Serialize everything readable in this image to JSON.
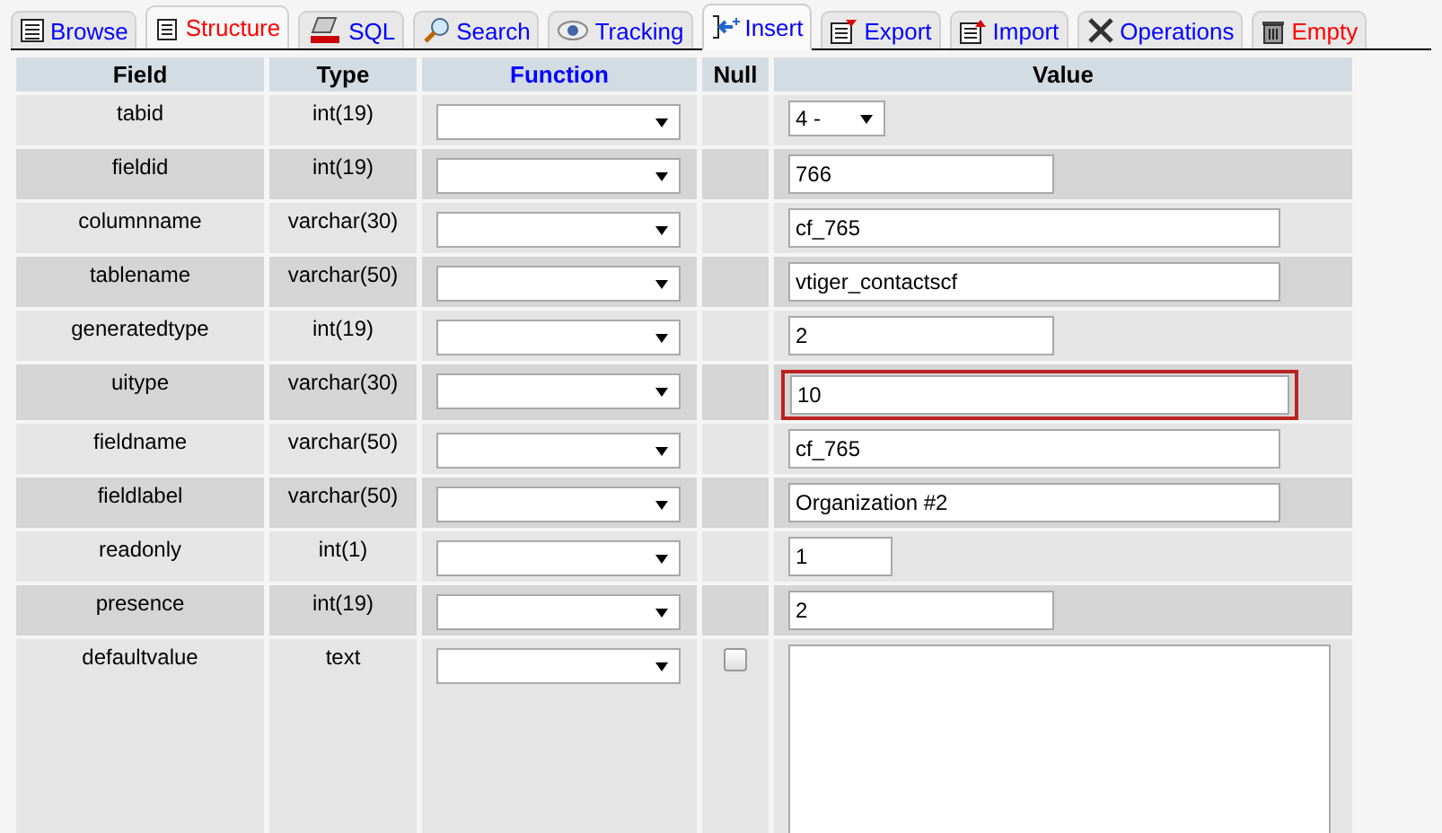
{
  "tabs": [
    {
      "label": "Browse",
      "selected": false,
      "hovered": false,
      "color": "#0000ff"
    },
    {
      "label": "Structure",
      "selected": false,
      "hovered": true,
      "color": "#ff0000"
    },
    {
      "label": "SQL",
      "selected": false,
      "hovered": false,
      "color": "#0000ff"
    },
    {
      "label": "Search",
      "selected": false,
      "hovered": false,
      "color": "#0000ff"
    },
    {
      "label": "Tracking",
      "selected": false,
      "hovered": false,
      "color": "#0000ff"
    },
    {
      "label": "Insert",
      "selected": true,
      "hovered": false,
      "color": "#0000ff"
    },
    {
      "label": "Export",
      "selected": false,
      "hovered": false,
      "color": "#0000ff"
    },
    {
      "label": "Import",
      "selected": false,
      "hovered": false,
      "color": "#0000ff"
    },
    {
      "label": "Operations",
      "selected": false,
      "hovered": false,
      "color": "#0000ff"
    },
    {
      "label": "Empty",
      "selected": false,
      "hovered": false,
      "color": "#ff0000"
    }
  ],
  "table": {
    "columns": [
      "Field",
      "Type",
      "Function",
      "Null",
      "Value"
    ],
    "rows": [
      {
        "field": "tabid",
        "type": "int(19)",
        "value": {
          "kind": "select",
          "text": "4 -"
        },
        "highlighted": false
      },
      {
        "field": "fieldid",
        "type": "int(19)",
        "value": {
          "kind": "input-medium",
          "text": "766"
        },
        "highlighted": false
      },
      {
        "field": "columnname",
        "type": "varchar(30)",
        "value": {
          "kind": "input-large",
          "text": "cf_765"
        },
        "highlighted": false
      },
      {
        "field": "tablename",
        "type": "varchar(50)",
        "value": {
          "kind": "input-large",
          "text": "vtiger_contactscf"
        },
        "highlighted": false
      },
      {
        "field": "generatedtype",
        "type": "int(19)",
        "value": {
          "kind": "input-medium",
          "text": "2"
        },
        "highlighted": false
      },
      {
        "field": "uitype",
        "type": "varchar(30)",
        "value": {
          "kind": "input-large",
          "text": "10"
        },
        "highlighted": true
      },
      {
        "field": "fieldname",
        "type": "varchar(50)",
        "value": {
          "kind": "input-large",
          "text": "cf_765"
        },
        "highlighted": false
      },
      {
        "field": "fieldlabel",
        "type": "varchar(50)",
        "value": {
          "kind": "input-large",
          "text": "Organization #2"
        },
        "highlighted": false
      },
      {
        "field": "readonly",
        "type": "int(1)",
        "value": {
          "kind": "input-small",
          "text": "1"
        },
        "highlighted": false
      },
      {
        "field": "presence",
        "type": "int(19)",
        "value": {
          "kind": "input-medium",
          "text": "2"
        },
        "highlighted": false
      },
      {
        "field": "defaultvalue",
        "type": "text",
        "null": {
          "checked": false
        },
        "value": {
          "kind": "textarea"
        },
        "highlighted": false
      }
    ]
  }
}
